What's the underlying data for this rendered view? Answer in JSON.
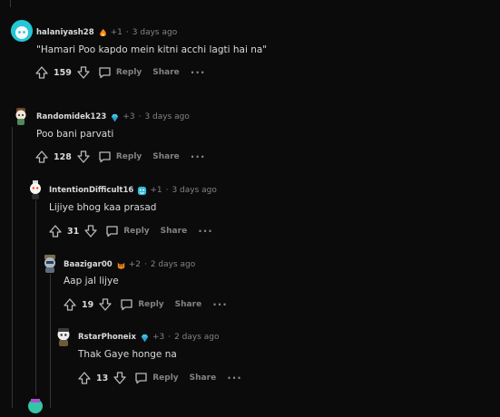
{
  "comments": [
    {
      "username": "halaniyash28",
      "karma": "+1",
      "time": "3 days ago",
      "text": "\"Hamari Poo kapdo mein kitni acchi lagti hai na\"",
      "score": "159",
      "reply_label": "Reply",
      "share_label": "Share",
      "more_label": "···"
    },
    {
      "username": "Randomidek123",
      "karma": "+3",
      "time": "3 days ago",
      "text": "Poo bani parvati",
      "score": "128",
      "reply_label": "Reply",
      "share_label": "Share",
      "more_label": "···"
    },
    {
      "username": "IntentionDifficult16",
      "karma": "+1",
      "time": "3 days ago",
      "text": "Lijiye bhog kaa prasad",
      "score": "31",
      "reply_label": "Reply",
      "share_label": "Share",
      "more_label": "···"
    },
    {
      "username": "Baazigar00",
      "karma": "+2",
      "time": "2 days ago",
      "text": "Aap jal lijye",
      "score": "19",
      "reply_label": "Reply",
      "share_label": "Share",
      "more_label": "···"
    },
    {
      "username": "RstarPhoneix",
      "karma": "+3",
      "time": "2 days ago",
      "text": "Thak Gaye honge na",
      "score": "13",
      "reply_label": "Reply",
      "share_label": "Share",
      "more_label": "···"
    }
  ],
  "separator": "·",
  "colors": {
    "background": "#0b0b0b",
    "text": "#d7dadc",
    "muted": "#818384",
    "thread_line": "#343536"
  }
}
